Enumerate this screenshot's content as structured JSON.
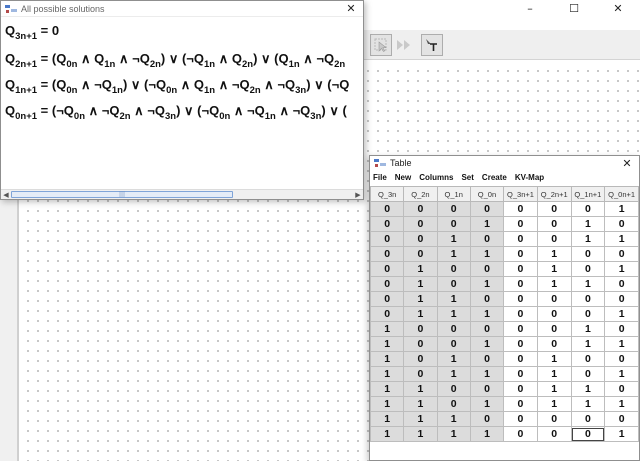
{
  "main_window": {
    "controls": [
      "–",
      "☐",
      "✕"
    ],
    "toolbar": [
      {
        "icon": "select-arrow-icon",
        "pressed": true
      },
      {
        "icon": "fast-forward-icon",
        "pressed": false
      },
      {
        "icon": "text-tool-icon",
        "pressed": true
      }
    ]
  },
  "solutions_window": {
    "title": "All possible solutions",
    "close": "✕",
    "scroll_arrow_left": "◀",
    "scroll_arrow_right": "▶",
    "scroll_grip": "|||"
  },
  "equations": [
    {
      "lhs": {
        "base": "Q",
        "sub": "3n+1"
      },
      "tokens": [
        {
          "t": " = 0"
        }
      ]
    },
    {
      "lhs": {
        "base": "Q",
        "sub": "2n+1"
      },
      "tokens": [
        {
          "t": " = (Q"
        },
        {
          "s": "0n"
        },
        {
          "t": " ∧ Q"
        },
        {
          "s": "1n"
        },
        {
          "t": " ∧ ¬Q"
        },
        {
          "s": "2n"
        },
        {
          "t": ") ∨ (¬Q"
        },
        {
          "s": "1n"
        },
        {
          "t": " ∧ Q"
        },
        {
          "s": "2n"
        },
        {
          "t": ") ∨ (Q"
        },
        {
          "s": "1n"
        },
        {
          "t": " ∧ ¬Q"
        },
        {
          "s": "2n"
        }
      ]
    },
    {
      "lhs": {
        "base": "Q",
        "sub": "1n+1"
      },
      "tokens": [
        {
          "t": " = (Q"
        },
        {
          "s": "0n"
        },
        {
          "t": " ∧ ¬Q"
        },
        {
          "s": "1n"
        },
        {
          "t": ") ∨ (¬Q"
        },
        {
          "s": "0n"
        },
        {
          "t": " ∧ Q"
        },
        {
          "s": "1n"
        },
        {
          "t": " ∧ ¬Q"
        },
        {
          "s": "2n"
        },
        {
          "t": " ∧ ¬Q"
        },
        {
          "s": "3n"
        },
        {
          "t": ") ∨ (¬Q"
        }
      ]
    },
    {
      "lhs": {
        "base": "Q",
        "sub": "0n+1"
      },
      "tokens": [
        {
          "t": " = (¬Q"
        },
        {
          "s": "0n"
        },
        {
          "t": " ∧ ¬Q"
        },
        {
          "s": "2n"
        },
        {
          "t": " ∧ ¬Q"
        },
        {
          "s": "3n"
        },
        {
          "t": ") ∨ (¬Q"
        },
        {
          "s": "0n"
        },
        {
          "t": " ∧ ¬Q"
        },
        {
          "s": "1n"
        },
        {
          "t": " ∧ ¬Q"
        },
        {
          "s": "3n"
        },
        {
          "t": ") ∨ ("
        }
      ]
    }
  ],
  "table_window": {
    "title": "Table",
    "close": "✕",
    "menu": [
      "File",
      "New",
      "Columns",
      "Set",
      "Create",
      "KV-Map"
    ],
    "columns": [
      "Q_3n",
      "Q_2n",
      "Q_1n",
      "Q_0n",
      "Q_3n+1",
      "Q_2n+1",
      "Q_1n+1",
      "Q_0n+1"
    ],
    "input_columns": 4,
    "selected_cell": {
      "row": 15,
      "col": 6
    },
    "rows": [
      [
        0,
        0,
        0,
        0,
        0,
        0,
        0,
        1
      ],
      [
        0,
        0,
        0,
        1,
        0,
        0,
        1,
        0
      ],
      [
        0,
        0,
        1,
        0,
        0,
        0,
        1,
        1
      ],
      [
        0,
        0,
        1,
        1,
        0,
        1,
        0,
        0
      ],
      [
        0,
        1,
        0,
        0,
        0,
        1,
        0,
        1
      ],
      [
        0,
        1,
        0,
        1,
        0,
        1,
        1,
        0
      ],
      [
        0,
        1,
        1,
        0,
        0,
        0,
        0,
        0
      ],
      [
        0,
        1,
        1,
        1,
        0,
        0,
        0,
        1
      ],
      [
        1,
        0,
        0,
        0,
        0,
        0,
        1,
        0
      ],
      [
        1,
        0,
        0,
        1,
        0,
        0,
        1,
        1
      ],
      [
        1,
        0,
        1,
        0,
        0,
        1,
        0,
        0
      ],
      [
        1,
        0,
        1,
        1,
        0,
        1,
        0,
        1
      ],
      [
        1,
        1,
        0,
        0,
        0,
        1,
        1,
        0
      ],
      [
        1,
        1,
        0,
        1,
        0,
        1,
        1,
        1
      ],
      [
        1,
        1,
        1,
        0,
        0,
        0,
        0,
        0
      ],
      [
        1,
        1,
        1,
        1,
        0,
        0,
        0,
        1
      ]
    ]
  }
}
